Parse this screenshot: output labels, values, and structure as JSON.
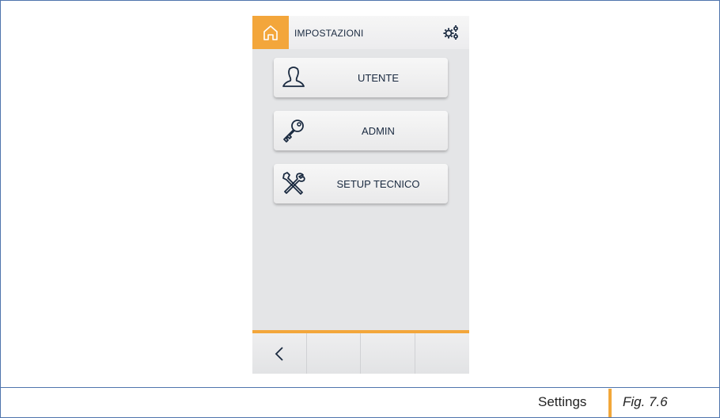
{
  "header": {
    "title": "IMPOSTAZIONI",
    "home_icon": "home-icon",
    "settings_icon": "gears-icon"
  },
  "menu": [
    {
      "label": "UTENTE",
      "icon": "user-icon"
    },
    {
      "label": "ADMIN",
      "icon": "key-icon"
    },
    {
      "label": "SETUP TECNICO",
      "icon": "tools-icon"
    }
  ],
  "navbar": {
    "back_icon": "chevron-left-icon"
  },
  "caption": {
    "label": "Settings",
    "figure": "Fig. 7.6"
  },
  "colors": {
    "accent": "#f3a63b",
    "text": "#1a2a40",
    "border": "#4f75ad"
  }
}
